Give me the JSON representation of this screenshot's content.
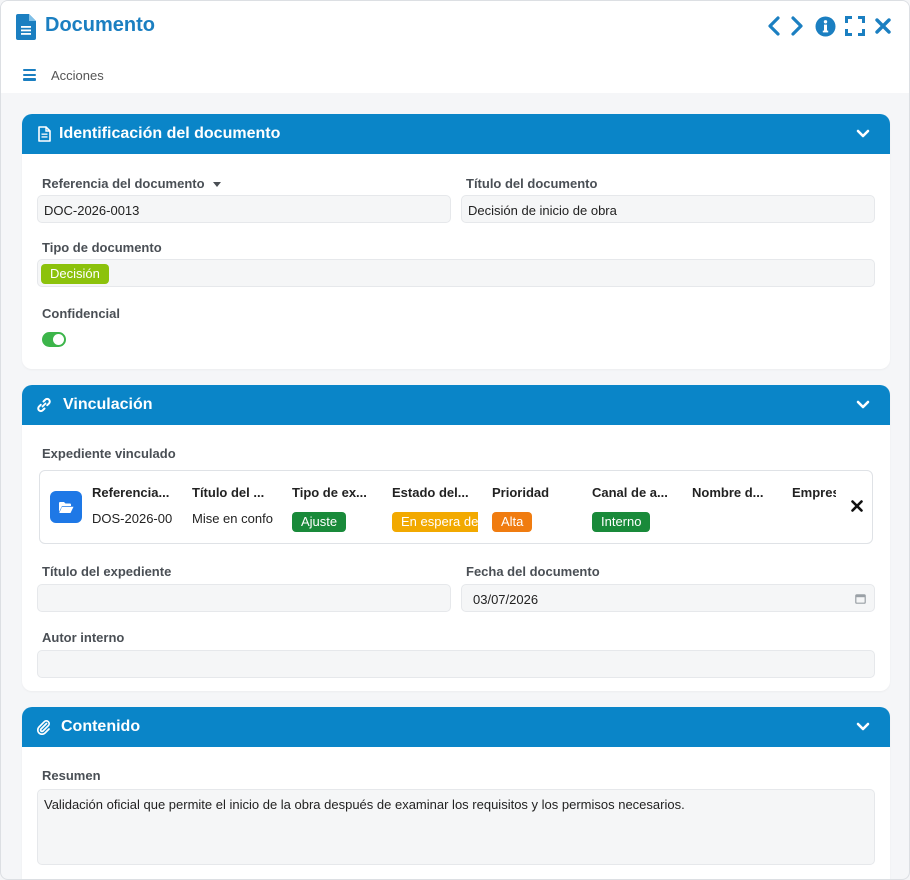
{
  "window": {
    "title": "Documento",
    "accent_color": "#1b7fc1",
    "buttons": [
      "chevron-left-icon",
      "chevron-right-icon",
      "info-icon",
      "expand-icon",
      "close-icon"
    ]
  },
  "actionbar": {
    "label": "Acciones"
  },
  "identificacion": {
    "header": "Identificación del documento",
    "referencia_label": "Referencia del documento",
    "referencia_value": "DOC-2026-0013",
    "titulo_label": "Título del documento",
    "titulo_value": "Decisión de inicio de obra",
    "tipo_label": "Tipo de documento",
    "tipo_value": "Decisión",
    "tipo_color": "#8cc20b",
    "confidencial_label": "Confidencial",
    "confidencial_on": true
  },
  "vinculacion": {
    "header": "Vinculación",
    "expediente_label": "Expediente vinculado",
    "linked": {
      "headers": [
        "Referencia...",
        "Título del ...",
        "Tipo de ex...",
        "Estado del...",
        "Prioridad",
        "Canal de a...",
        "Nombre d...",
        "Empres"
      ],
      "referencia": "DOS-2026-00",
      "titulo": "Mise en confo",
      "tipo": "Ajuste",
      "tipo_color": "#198a3a",
      "estado": "En espera de",
      "estado_color": "#f2a900",
      "prioridad": "Alta",
      "prioridad_color": "#f07c10",
      "canal": "Interno",
      "canal_color": "#198a3a"
    },
    "titulo_exp_label": "Título del expediente",
    "titulo_exp_value": "",
    "fecha_label": "Fecha del documento",
    "fecha_value": "03/07/2026",
    "autor_label": "Autor interno",
    "autor_value": ""
  },
  "contenido": {
    "header": "Contenido",
    "resumen_label": "Resumen",
    "resumen_value": "Validación oficial que permite el inicio de la obra después de examinar los requisitos y los permisos necesarios."
  }
}
